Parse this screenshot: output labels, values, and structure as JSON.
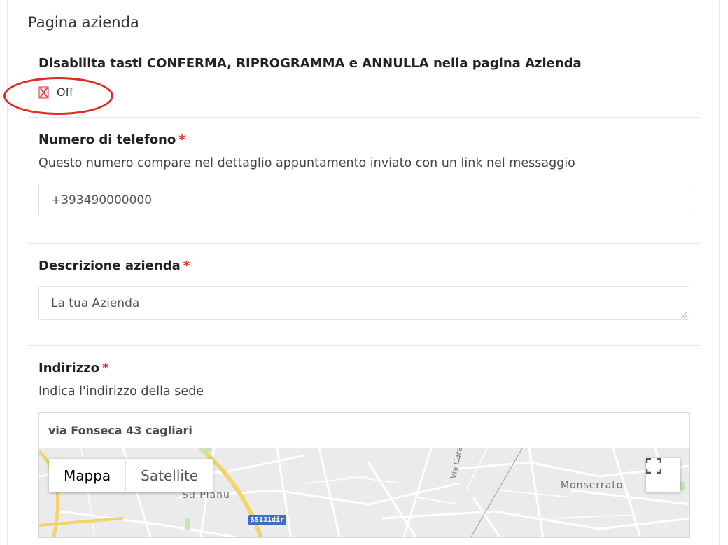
{
  "section": {
    "title": "Pagina azienda"
  },
  "disable_buttons": {
    "label": "Disabilita tasti CONFERMA, RIPROGRAMMA e ANNULLA nella pagina Azienda",
    "toggle_state": "Off"
  },
  "phone": {
    "label": "Numero di telefono",
    "required_mark": "*",
    "help": "Questo numero compare nel dettaglio appuntamento inviato con un link nel messaggio",
    "value": "+393490000000"
  },
  "description": {
    "label": "Descrizione azienda",
    "required_mark": "*",
    "value": "La tua Azienda"
  },
  "address": {
    "label": "Indirizzo",
    "required_mark": "*",
    "help": "Indica l'indirizzo della sede",
    "value": "via Fonseca 43 cagliari"
  },
  "map": {
    "type_options": [
      "Mappa",
      "Satellite"
    ],
    "selected_type": "Mappa",
    "labels": {
      "monserrato": "Monserrato",
      "su_planu": "Su Planu",
      "via_caracalla": "Via Caracalla",
      "road_shield": "SS131dir"
    }
  },
  "colors": {
    "required": "#e0302a",
    "highlight_ring": "#e32a22",
    "shield": "#3c6fbe"
  },
  "icons": {
    "toggle": "crossed-checkbox-icon",
    "fullscreen": "fullscreen-icon"
  }
}
